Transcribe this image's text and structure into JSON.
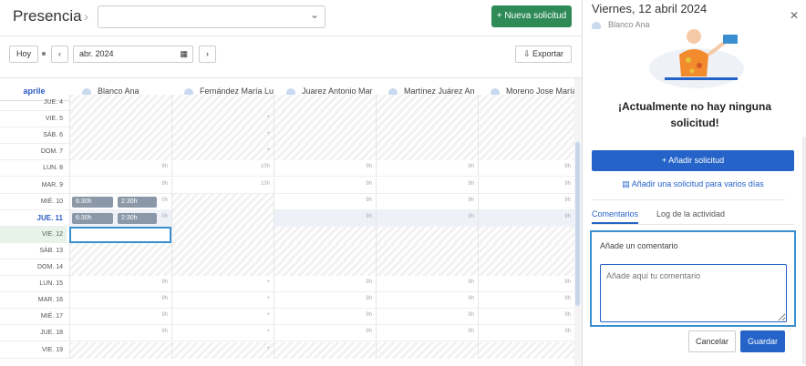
{
  "header": {
    "title": "Presencia",
    "breadcrumb_sep": "›",
    "select_caret": "⌄",
    "new_request_label": "+ Nueva solicitud"
  },
  "toolbar": {
    "today_label": "Hoy",
    "prev_icon": "‹",
    "next_icon": "›",
    "date_value": "abr. 2024",
    "calendar_icon": "▦",
    "export_label": "Exportar",
    "export_icon": "⇩"
  },
  "grid": {
    "month_label": "aprile",
    "employees": [
      "Blanco Ana",
      "Fernández María Lu",
      "Juarez Antonio Mar",
      "Martínez Juárez An",
      "Moreno Jose María"
    ],
    "rows": [
      {
        "label": "JUE. 4",
        "cells": [
          "",
          "",
          "",
          "",
          ""
        ],
        "type": "hatch"
      },
      {
        "label": "VIE. 5",
        "cells": [
          "",
          "+",
          "",
          "",
          ""
        ],
        "type": "hatch"
      },
      {
        "label": "SÁB. 6",
        "cells": [
          "",
          "+",
          "",
          "",
          ""
        ],
        "type": "hatch"
      },
      {
        "label": "DOM. 7",
        "cells": [
          "",
          "+",
          "",
          "",
          ""
        ],
        "type": "hatch"
      },
      {
        "label": "LUN. 8",
        "cells": [
          "9h",
          "10h",
          "9h",
          "9h",
          "9h"
        ],
        "type": "normal"
      },
      {
        "label": "MAR. 9",
        "cells": [
          "9h",
          "10h",
          "9h",
          "9h",
          "9h"
        ],
        "type": "normal"
      },
      {
        "label": "MIÉ. 10",
        "cells": [
          "0h",
          "",
          "9h",
          "9h",
          "9h"
        ],
        "type": "wed"
      },
      {
        "label": "JUE. 11",
        "cells": [
          "0h",
          "",
          "9h",
          "9h",
          "9h"
        ],
        "type": "today"
      },
      {
        "label": "VIE. 12",
        "cells": [
          "",
          "",
          "",
          "",
          ""
        ],
        "type": "sel"
      },
      {
        "label": "SÁB. 13",
        "cells": [
          "",
          "",
          "",
          "",
          ""
        ],
        "type": "hatch"
      },
      {
        "label": "DOM. 14",
        "cells": [
          "",
          "",
          "",
          "",
          ""
        ],
        "type": "hatch"
      },
      {
        "label": "LUN. 15",
        "cells": [
          "9h",
          "+",
          "9h",
          "9h",
          "9h"
        ],
        "type": "normal"
      },
      {
        "label": "MAR. 16",
        "cells": [
          "9h",
          "+",
          "9h",
          "9h",
          "9h"
        ],
        "type": "normal"
      },
      {
        "label": "MIÉ. 17",
        "cells": [
          "9h",
          "+",
          "9h",
          "9h",
          "9h"
        ],
        "type": "normal"
      },
      {
        "label": "JUE. 18",
        "cells": [
          "9h",
          "+",
          "9h",
          "9h",
          "9h"
        ],
        "type": "normal"
      },
      {
        "label": "VIE. 19",
        "cells": [
          "",
          "+",
          "",
          "",
          ""
        ],
        "type": "hatch"
      }
    ],
    "pills": {
      "wed_a": "6:30h",
      "wed_b": "2:30h",
      "thu_a": "6:30h",
      "thu_b": "2:30h"
    }
  },
  "panel": {
    "title": "Viernes, 12 abril 2024",
    "close_icon": "✕",
    "user": "Blanco Ana",
    "message": "¡Actualmente no hay ninguna solicitud!",
    "add_label": "+ Añadir solicitud",
    "multi_label": "Añadir una solicitud para varios días",
    "tabs": [
      "Comentarios",
      "Log de la actividad"
    ],
    "comment_label": "Añade un comentario",
    "comment_placeholder": "Añade aquí tu comentario",
    "cancel_label": "Cancelar",
    "save_label": "Guardar"
  },
  "colors": {
    "brand_green": "#2e8b57",
    "brand_blue": "#2563c9",
    "focus_blue": "#3a8fd0"
  }
}
